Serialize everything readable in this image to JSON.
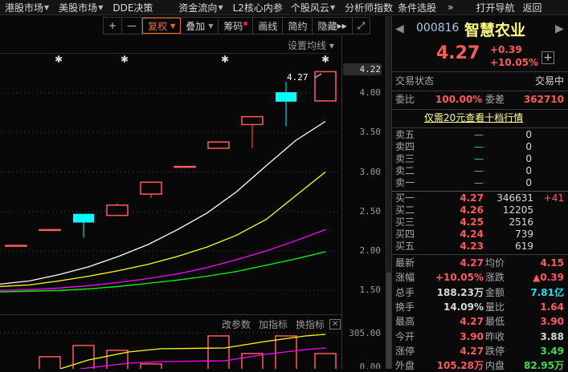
{
  "menu": {
    "items": [
      {
        "label": "港股市场",
        "caret": true
      },
      {
        "label": "美股市场",
        "caret": true
      },
      {
        "label": "DDE决策",
        "caret": false
      },
      {
        "label": "资金流向",
        "caret": true
      },
      {
        "label": "L2核心内参",
        "caret": false
      },
      {
        "label": "个股风云",
        "caret": true
      },
      {
        "label": "分析师指数",
        "caret": false
      },
      {
        "label": "条件选股",
        "caret": false
      }
    ],
    "more": "»",
    "open_nav": "打开导航",
    "back": "返回"
  },
  "toolbar": {
    "plus": "+",
    "minus": "—",
    "fuquan": "复权",
    "overlay": "叠加",
    "chips": "筹码",
    "draw": "画线",
    "simple": "简约",
    "hide": "隐藏",
    "expand": "⤢"
  },
  "chart": {
    "ma_setting": "设置均线 ▾",
    "current_price_label": "4.22",
    "last_label": "4.27",
    "y_ticks": [
      "4.00",
      "3.50",
      "3.00",
      "2.50",
      "2.00",
      "1.50"
    ],
    "y_tick_values": [
      4.0,
      3.5,
      3.0,
      2.5,
      2.0,
      1.5
    ],
    "candles": [
      {
        "o": 2.07,
        "h": 2.07,
        "l": 2.07,
        "c": 2.07,
        "color": "#ff5a5a"
      },
      {
        "o": 2.27,
        "h": 2.27,
        "l": 2.25,
        "c": 2.27,
        "color": "#ff5a5a"
      },
      {
        "o": 2.47,
        "h": 2.47,
        "l": 2.17,
        "c": 2.36,
        "color": "#00ffff",
        "filled": true
      },
      {
        "o": 2.45,
        "h": 2.6,
        "l": 2.45,
        "c": 2.58,
        "color": "#ff5a5a"
      },
      {
        "o": 2.72,
        "h": 2.87,
        "l": 2.67,
        "c": 2.87,
        "color": "#ff5a5a"
      },
      {
        "o": 3.07,
        "h": 3.07,
        "l": 3.07,
        "c": 3.07,
        "color": "#ff5a5a"
      },
      {
        "o": 3.3,
        "h": 3.38,
        "l": 3.3,
        "c": 3.38,
        "color": "#ff5a5a"
      },
      {
        "o": 3.6,
        "h": 3.7,
        "l": 3.3,
        "c": 3.7,
        "color": "#ff5a5a"
      },
      {
        "o": 4.01,
        "h": 4.14,
        "l": 3.58,
        "c": 3.89,
        "color": "#00ffff",
        "filled": true
      },
      {
        "o": 3.9,
        "h": 4.27,
        "l": 3.9,
        "c": 4.27,
        "color": "#ff5a5a"
      }
    ],
    "ma": [
      {
        "color": "#ffffff",
        "values": [
          1.58,
          1.62,
          1.7,
          1.8,
          1.93,
          2.08,
          2.27,
          2.48,
          2.75,
          3.08,
          3.4,
          3.64
        ]
      },
      {
        "color": "#ffff00",
        "values": [
          1.55,
          1.57,
          1.62,
          1.68,
          1.75,
          1.83,
          1.93,
          2.05,
          2.2,
          2.4,
          2.7,
          3.0
        ]
      },
      {
        "color": "#ff00ff",
        "values": [
          1.5,
          1.51,
          1.53,
          1.56,
          1.6,
          1.65,
          1.71,
          1.79,
          1.89,
          2.0,
          2.13,
          2.27
        ]
      },
      {
        "color": "#00ff00",
        "values": [
          1.48,
          1.49,
          1.5,
          1.52,
          1.55,
          1.59,
          1.63,
          1.68,
          1.74,
          1.82,
          1.9,
          1.99
        ]
      }
    ],
    "volume": {
      "max_label": "305.00",
      "zero_label": "0.00",
      "max": 305,
      "bars": [
        0,
        102,
        197,
        156,
        41,
        0,
        278,
        129,
        278,
        129
      ],
      "params": "改参数",
      "add": "加指标",
      "switch": "换指标",
      "close": "✕"
    }
  },
  "quote": {
    "code": "000816",
    "name": "智慧农业",
    "price": "4.27",
    "change": "+0.39",
    "pct": "+10.05%",
    "add": "+",
    "status_label": "交易状态",
    "status": "交易中",
    "wb_label": "委比",
    "wb": "100.00%",
    "wc_label": "委差",
    "wc": "362710",
    "promo": "仅需20元查看十档行情",
    "sell": [
      {
        "l": "卖五",
        "p": "—",
        "v": "0"
      },
      {
        "l": "卖四",
        "p": "—",
        "v": "0"
      },
      {
        "l": "卖三",
        "p": "—",
        "v": "0"
      },
      {
        "l": "卖二",
        "p": "—",
        "v": "0"
      },
      {
        "l": "卖一",
        "p": "—",
        "v": "0"
      }
    ],
    "buy": [
      {
        "l": "买一",
        "p": "4.27",
        "v": "346631",
        "d": "+41"
      },
      {
        "l": "买二",
        "p": "4.26",
        "v": "12205",
        "d": ""
      },
      {
        "l": "买三",
        "p": "4.25",
        "v": "2516",
        "d": ""
      },
      {
        "l": "买四",
        "p": "4.24",
        "v": "739",
        "d": ""
      },
      {
        "l": "买五",
        "p": "4.23",
        "v": "619",
        "d": ""
      }
    ],
    "stats": [
      {
        "l1": "最新",
        "v1": "4.27",
        "c1": "red",
        "l2": "均价",
        "v2": "4.15",
        "c2": "red"
      },
      {
        "l1": "涨幅",
        "v1": "+10.05%",
        "c1": "red",
        "l2": "涨跌",
        "v2": "▲0.39",
        "c2": "red"
      },
      {
        "l1": "总手",
        "v1": "188.23万",
        "c1": "white",
        "l2": "金额",
        "v2": "7.81亿",
        "c2": "cyan"
      },
      {
        "l1": "换手",
        "v1": "14.09%",
        "c1": "white",
        "l2": "量比",
        "v2": "1.64",
        "c2": "red"
      },
      {
        "l1": "最高",
        "v1": "4.27",
        "c1": "red",
        "l2": "最低",
        "v2": "3.90",
        "c2": "red"
      },
      {
        "l1": "今开",
        "v1": "3.90",
        "c1": "red",
        "l2": "昨收",
        "v2": "3.88",
        "c2": "white"
      },
      {
        "l1": "涨停",
        "v1": "4.27",
        "c1": "red",
        "l2": "跌停",
        "v2": "3.49",
        "c2": "green"
      },
      {
        "l1": "外盘",
        "v1": "105.28万",
        "c1": "red",
        "l2": "内盘",
        "v2": "82.95万",
        "c2": "green"
      }
    ]
  }
}
